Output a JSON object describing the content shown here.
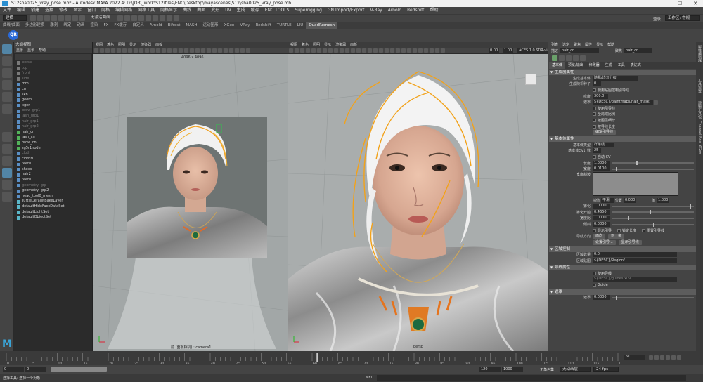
{
  "window": {
    "title": "S12sha0025_vray_pose.mb* - Autodesk MAYA 2022.4: D:\\JOB\\_work\\S12\\files\\ENC\\Desktop\\mayascenes\\S12\\sha0025_vray_pose.mb",
    "controls": [
      "—",
      "☐",
      "✕"
    ]
  },
  "menubar": {
    "items": [
      "文件",
      "编辑",
      "创建",
      "选择",
      "修改",
      "显示",
      "窗口",
      "网格",
      "编辑网格",
      "网格工具",
      "网格显示",
      "曲线",
      "曲面",
      "变形",
      "UV",
      "生成",
      "缓存",
      "ENC TOOLS",
      "Superrigging",
      "GN Import/Export",
      "V-Ray",
      "Arnold",
      "Redshift",
      "帮助"
    ]
  },
  "statusline": {
    "mode_dropdown": "建模",
    "no_live_surface": "无激活曲面",
    "login": "登录",
    "workspace": "工作区: 常规"
  },
  "shelf": {
    "tabs": [
      "曲线/曲面",
      "多边形建模",
      "雕刻",
      "绑定",
      "动画",
      "渲染",
      "FX",
      "FX缓存",
      "自定义",
      "Arnold",
      "Bifrost",
      "MASH",
      "运动图形",
      "XGen",
      "VRay",
      "Redshift",
      "TURTLE",
      "LIU",
      "QuadRemesh"
    ],
    "active_tab": "QuadRemesh",
    "qr_button": "QR"
  },
  "outliner": {
    "title": "大纲视图",
    "menu": [
      "显示",
      "显示",
      "帮助"
    ],
    "items": [
      {
        "label": "persp",
        "icon": "camera",
        "dim": true
      },
      {
        "label": "top",
        "icon": "camera",
        "dim": true
      },
      {
        "label": "front",
        "icon": "camera",
        "dim": true
      },
      {
        "label": "side",
        "icon": "camera",
        "dim": true
      },
      {
        "label": "mm",
        "icon": "transform",
        "dim": false
      },
      {
        "label": "cn",
        "icon": "transform",
        "dim": false
      },
      {
        "label": "skn",
        "icon": "transform",
        "dim": false
      },
      {
        "label": "geom",
        "icon": "transform",
        "dim": false
      },
      {
        "label": "xgen",
        "icon": "transform",
        "dim": false
      },
      {
        "label": "brow_grp1",
        "icon": "transform",
        "dim": true
      },
      {
        "label": "lash_grp1",
        "icon": "transform",
        "dim": true
      },
      {
        "label": "hair_grp1",
        "icon": "transform",
        "dim": true
      },
      {
        "label": "hair_grp2",
        "icon": "transform",
        "dim": true
      },
      {
        "label": "hair_cn",
        "icon": "curve",
        "dim": false
      },
      {
        "label": "lash_cn",
        "icon": "curve",
        "dim": false
      },
      {
        "label": "brow_cn",
        "icon": "curve",
        "dim": false
      },
      {
        "label": "sg5r1node",
        "icon": "curve",
        "dim": false
      },
      {
        "label": "cloth",
        "icon": "transform",
        "dim": true
      },
      {
        "label": "clothN",
        "icon": "transform",
        "dim": false
      },
      {
        "label": "teeth",
        "icon": "transform",
        "dim": false
      },
      {
        "label": "shoes",
        "icon": "transform",
        "dim": false
      },
      {
        "label": "hair2",
        "icon": "transform",
        "dim": false
      },
      {
        "label": "teeth",
        "icon": "transform",
        "dim": false
      },
      {
        "label": "geometry_grp",
        "icon": "transform",
        "dim": true
      },
      {
        "label": "geometry_grp2",
        "icon": "transform",
        "dim": false
      },
      {
        "label": "head_tool0_mesh",
        "icon": "transform",
        "dim": false
      },
      {
        "label": "TurtleDefaultBakeLayer",
        "icon": "set",
        "dim": false
      },
      {
        "label": "defaultHideFaceDataSet",
        "icon": "set",
        "dim": false
      },
      {
        "label": "defaultLightSet",
        "icon": "set",
        "dim": false
      },
      {
        "label": "defaultObjectSet",
        "icon": "set",
        "dim": false
      }
    ]
  },
  "viewport1": {
    "menu": [
      "视图",
      "着色",
      "照明",
      "显示",
      "渲染器",
      "面板"
    ],
    "resolution_label": "4096 x 4096",
    "camera_label": "前 (面板相机) : camera1"
  },
  "viewport2": {
    "menu": [
      "视图",
      "着色",
      "照明",
      "显示",
      "渲染器",
      "面板"
    ],
    "field_a": "0.00",
    "field_b": "1.00",
    "colorspace": "ACES 1.0 SDR-video (sRGB gamma 2.2)",
    "camera_label": "persp"
  },
  "attribute_editor": {
    "menu": [
      "列表",
      "选定",
      "聚焦",
      "属性",
      "显示",
      "帮助"
    ],
    "node_type_label": "描述",
    "node_name": "hair_cn",
    "focus_label": "聚焦",
    "preset_label": "预设",
    "tabs": [
      "基本体",
      "预览/输出",
      "修改器",
      "生成",
      "工具",
      "表达式"
    ],
    "active_tab": "基本体",
    "sections": {
      "generate": "生成器属性",
      "primitive": "基本体属性",
      "region": "区域控制",
      "expr": "导线属性",
      "mask": "遮罩"
    },
    "rows": {
      "spline_mode": {
        "label": "生成基本体",
        "value": "随机/均匀分布"
      },
      "seed": {
        "label": "生成随机种子",
        "value": "0"
      },
      "use_map": "使用贴图控制引导线",
      "density_label": "密度",
      "density": "300.0",
      "mask_label": "遮罩",
      "mask": "${DESC}/paintmaps/hair_mask",
      "opt1": "使用引导线",
      "opt2": "全局成比例",
      "opt3": "按图层细分",
      "opt4": "按导线长度",
      "extra_btn": "编辑引导线",
      "prim_type_label": "基本体类型",
      "prim_type": "样条线",
      "cv_label": "基本体CV计数",
      "cv_count": "25",
      "cv_option": "自动 CV",
      "length_label": "长度",
      "length": "1.0000",
      "width_label": "宽度",
      "width": "0.0100",
      "profile_label": "宽度斜坡",
      "interp_label": "插值",
      "interp_value": "平滑",
      "pos_label": "位置",
      "pos_value": "0.000",
      "val_label": "值",
      "val_value": "1.000",
      "taper_label": "锥化",
      "taper": "1.0000",
      "taper_start_label": "锥化开始",
      "taper_start": "0.4650",
      "width_scale_label": "宽度比",
      "width_scale": "1.0000",
      "tilt_label": "倾斜",
      "tilt": "0.0000",
      "check_a": "显示引导",
      "check_b": "锁定长度",
      "check_c": "重置引导线",
      "face_label": "导线方向",
      "face_a": "面向",
      "face_b": "到一条",
      "btn_a": "设置引导...",
      "btn_b": "显示引导线",
      "region_label": "区域数量",
      "region_value": "0.0",
      "region_map_label": "区域贴图",
      "region_map": "${DESC}/Region/",
      "expr_check": "使用导线",
      "expr_field": "${DESC}/guides.xuv",
      "expr_check2": "Guide",
      "mask_label2": "遮罩",
      "mask_value": "0.0000"
    },
    "right_tabs": [
      "属性编辑器",
      "工具设置",
      "建模工具包",
      "Channel Box",
      "XGen"
    ]
  },
  "timeline": {
    "ticks": [
      "0",
      "5",
      "10",
      "15",
      "20",
      "25",
      "30",
      "35",
      "40",
      "45",
      "50",
      "55",
      "60",
      "65",
      "70",
      "75",
      "80",
      "85",
      "90",
      "95",
      "100",
      "105",
      "110",
      "115",
      "120"
    ],
    "current_frame": "61"
  },
  "range": {
    "start": "0",
    "start2": "0",
    "end": "120",
    "end2": "1000",
    "anim_start": "120",
    "anim_end": "1000",
    "char_set": "无角色集",
    "anim_layer": "无动画层",
    "fps": "24 fps"
  },
  "cmdline": {
    "help_text": "选择工具: 选择一个对象",
    "mel_label": "MEL"
  }
}
